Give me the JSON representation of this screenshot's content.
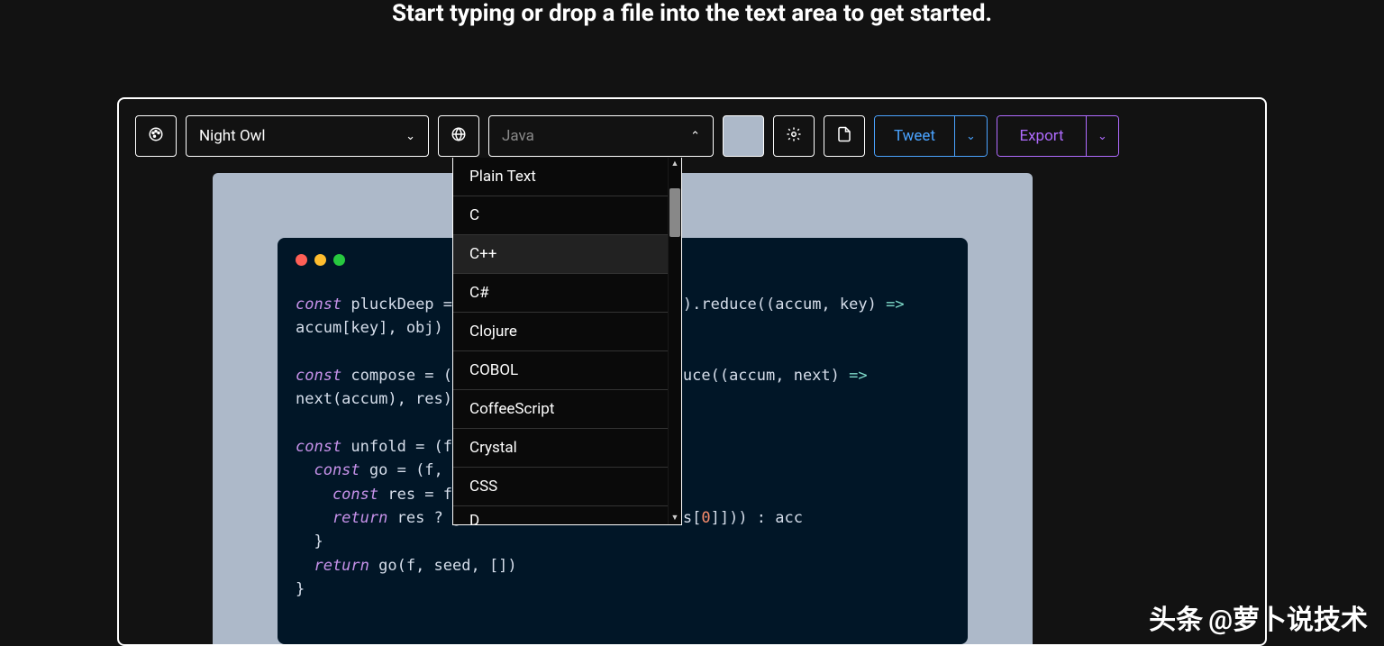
{
  "headline": "Start typing or drop a file into the text area to get started.",
  "toolbar": {
    "theme_selected": "Night Owl",
    "language_selected": "Java",
    "tweet_label": "Tweet",
    "export_label": "Export",
    "swatch_color": "#adb9c9"
  },
  "dropdown": {
    "options": [
      "Plain Text",
      "C",
      "C++",
      "C#",
      "Clojure",
      "COBOL",
      "CoffeeScript",
      "Crystal",
      "CSS",
      "D"
    ],
    "hovered_index": 2
  },
  "code": {
    "line1a": "const",
    "line1b": " pluckDeep = ",
    "line1c": "'.'",
    "line1d": ").reduce((accum, key) ",
    "line1e": "=>",
    "line2": "accum[key], obj)",
    "line3a": "const",
    "line3b": " compose = (.",
    "line3c": "duce((accum, next) ",
    "line3d": "=>",
    "line4": "next(accum), res)",
    "line5a": "const",
    "line5b": " unfold = (f,",
    "line6a": "  const",
    "line6b": " go = (f, s",
    "line7a": "    const",
    "line7b": " res = f(",
    "line8a": "    return",
    "line8b": " res ? g",
    "line8c": "([res[",
    "line8d": "0",
    "line8e": "]])) : acc",
    "line9": "  }",
    "line10a": "  return",
    "line10b": " go(f, seed, [])",
    "line11": "}"
  },
  "watermark": {
    "brand": "头条",
    "handle": "@萝卜说技术"
  }
}
